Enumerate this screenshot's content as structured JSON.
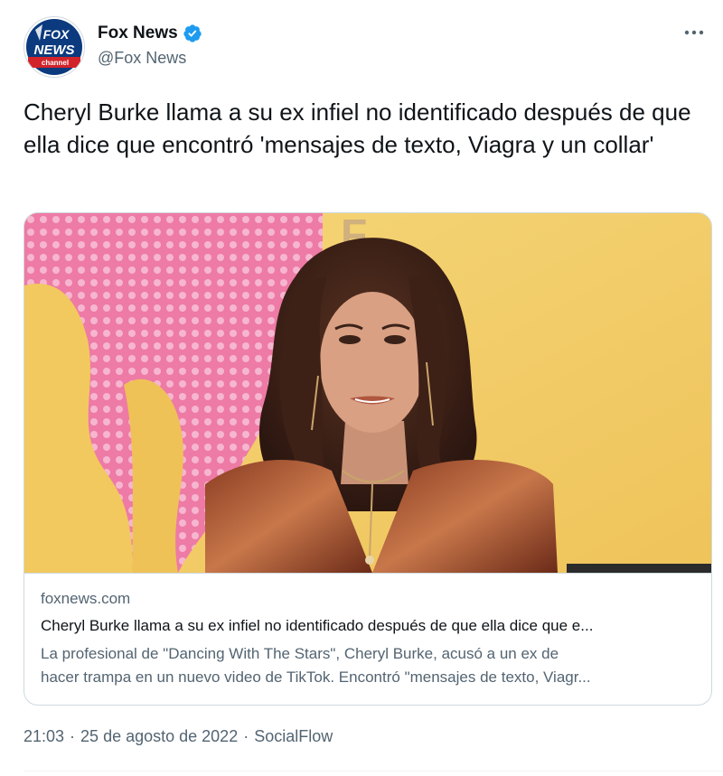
{
  "author": {
    "name": "Fox News",
    "handle": "@Fox News",
    "logo_text_top": "FOX",
    "logo_text_mid": "NEWS",
    "logo_text_bottom": "channel"
  },
  "tweet": {
    "text": "Cheryl Burke llama a su ex infiel no identificado después de que ella dice que encontró 'mensajes de texto, Viagra y un collar'"
  },
  "card": {
    "domain": "foxnews.com",
    "title": "Cheryl Burke llama a su ex infiel no identificado después de que ella dice que e...",
    "description_line1": "La profesional de \"Dancing With The Stars\", Cheryl Burke, acusó a un ex de",
    "description_line2": "hacer trampa en un nuevo video de TikTok. Encontró \"mensajes de texto, Viagr..."
  },
  "meta": {
    "time": "21:03",
    "date": "25 de agosto de 2022",
    "separator": "·",
    "source": "SocialFlow"
  },
  "icons": {
    "verified": "verified-badge-icon",
    "more": "more-options-icon"
  },
  "colors": {
    "verified_blue": "#1d9bf0",
    "fox_blue": "#0b3a7e",
    "fox_red": "#d2232a",
    "secondary_text": "#536471"
  }
}
